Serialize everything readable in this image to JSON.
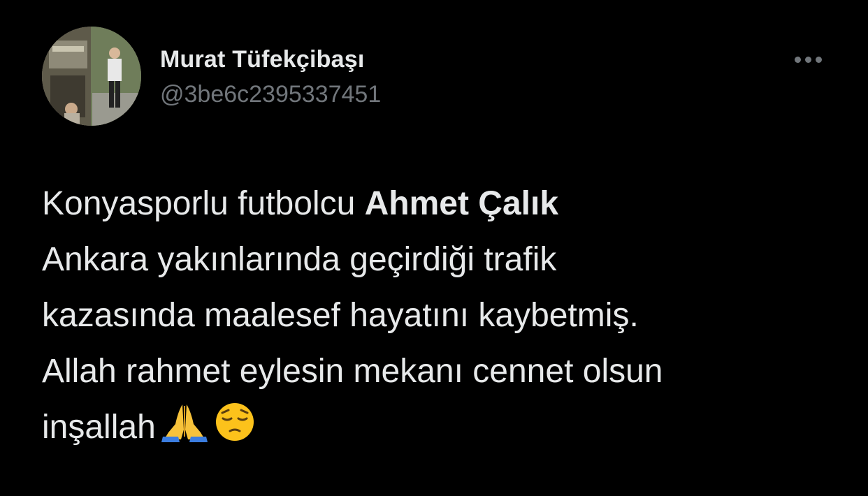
{
  "tweet": {
    "author": {
      "display_name": "Murat Tüfekçibaşı",
      "handle": "@3be6c2395337451"
    },
    "menu_icon": "more-horizontal-icon",
    "body": {
      "line1_text": "Konyasporlu futbolcu ",
      "line1_bold": "Ahmet Çalık",
      "line2": "Ankara yakınlarında geçirdiği trafik",
      "line3": "kazasında maalesef hayatını kaybetmiş.",
      "line4": "Allah rahmet eylesin mekanı cennet olsun",
      "line5_text": "inşallah",
      "emojis": [
        "folded-hands-emoji",
        "pensive-face-emoji"
      ]
    }
  },
  "colors": {
    "background": "#000000",
    "primary_text": "#e7e9ea",
    "secondary_text": "#71767b"
  }
}
